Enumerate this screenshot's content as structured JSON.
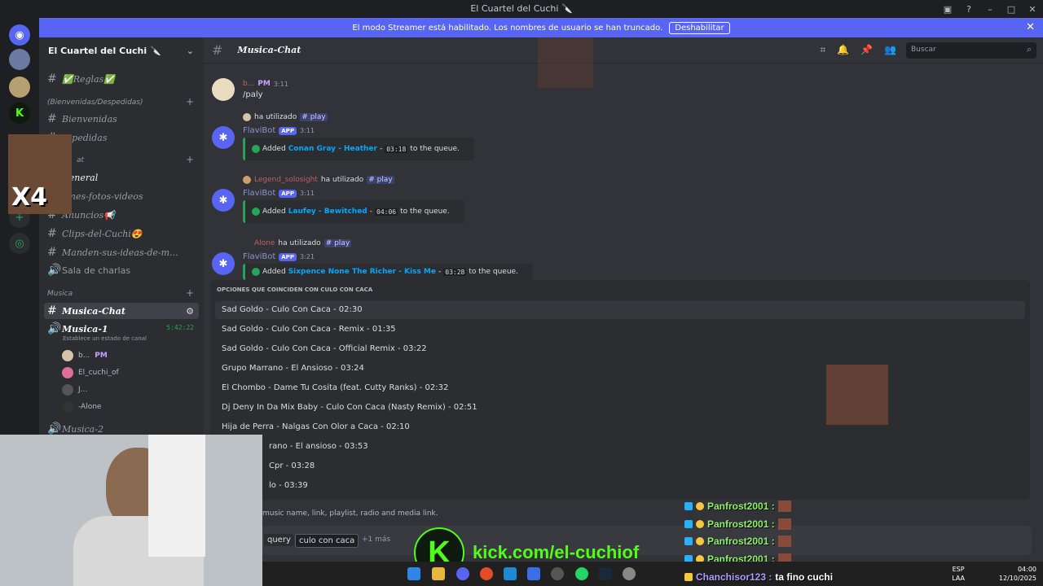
{
  "window": {
    "title": "El Cuartel del Cuchi 🔪"
  },
  "banner": {
    "text": "El modo Streamer está habilitado. Los nombres de usuario se han truncado.",
    "button": "Deshabilitar"
  },
  "sidebar": {
    "server_name": "El Cuartel del Cuchi 🔪",
    "channels": [
      {
        "label": "✅Reglas✅"
      },
      {
        "label": "Bienvenidas"
      },
      {
        "label": "espedidas"
      },
      {
        "label": "General"
      },
      {
        "label": "emes-fotos-videos"
      },
      {
        "label": "Anuncios📢"
      },
      {
        "label": "Clips-del-Cuchi😍"
      },
      {
        "label": "Manden-sus-ideas-de-m..."
      },
      {
        "label": "Sala de charlas"
      }
    ],
    "categories": {
      "welcome": "(Bienvenidas/Despedidas)",
      "chat": "at",
      "music": "Musica"
    },
    "music_channels": {
      "active": "Musica-Chat",
      "voice": "Musica-1",
      "voice_status": "Establece un estado de canal",
      "voice_timer": "5:42:22",
      "voice2": "Musica-2"
    },
    "voice_users": [
      {
        "name": "b...",
        "tag": "PM"
      },
      {
        "name": "El_cuchi_of"
      },
      {
        "name": "J..."
      },
      {
        "name": "-Alone"
      }
    ]
  },
  "header": {
    "channel": "Musica-Chat",
    "search_placeholder": "Buscar"
  },
  "messages": {
    "user_time": "3:11",
    "user_tag": "PM",
    "user_text": "/paly",
    "used": "ha utilizado",
    "command": "play",
    "bot_name": "FlaviBot",
    "app": "APP",
    "users": [
      "Legend_solosight",
      "Alone"
    ],
    "entries": [
      {
        "time": "3:11",
        "added": "Added",
        "song": "Conan Gray - Heather",
        "dur": "03:18",
        "tail": "to the queue."
      },
      {
        "time": "3:11",
        "added": "Added",
        "song": "Laufey - Bewitched",
        "dur": "04:06",
        "tail": "to the queue."
      },
      {
        "time": "3:21",
        "added": "Added",
        "song": "Sixpence None The Richer - Kiss Me",
        "dur": "03:28",
        "tail": "to the queue."
      }
    ]
  },
  "autocomplete": {
    "header": "OPCIONES QUE COINCIDEN CON CULO CON CACA",
    "items": [
      "Sad Goldo - Culo Con Caca - 02:30",
      "Sad Goldo - Culo Con Caca - Remix - 01:35",
      "Sad Goldo - Culo Con Caca - Official Remix - 03:22",
      "Grupo Marrano - El Ansioso - 03:24",
      "El Chombo - Dame Tu Cosita (feat. Cutty Ranks) - 02:32",
      "Dj Deny In Da Mix Baby - Culo Con Caca (Nasty Remix) - 02:51",
      "Hija de Perra - Nalgas Con Olor a Caca - 02:10",
      "rano - El ansioso - 03:53",
      "Cpr - 03:28",
      "lo - 03:39"
    ]
  },
  "input": {
    "hint": "music name, link, playlist, radio and media link.",
    "param": "query",
    "value": "culo con caca",
    "more": "+1 más"
  },
  "overlay": {
    "meme_label": "X4",
    "kick_letter": "K",
    "kick_url": "kick.com/el-cuchiof",
    "chat": [
      {
        "user": "Panfrost2001 :"
      },
      {
        "user": "Panfrost2001 :"
      },
      {
        "user": "Panfrost2001 :"
      },
      {
        "user": "Panfrost2001 :"
      }
    ],
    "last_chat": {
      "user": "Chanchisor123 :",
      "msg": "ta fino cuchi"
    }
  },
  "taskbar": {
    "lang1": "ESP",
    "lang2": "LAA",
    "time": "04:00",
    "date": "12/10/2025"
  }
}
